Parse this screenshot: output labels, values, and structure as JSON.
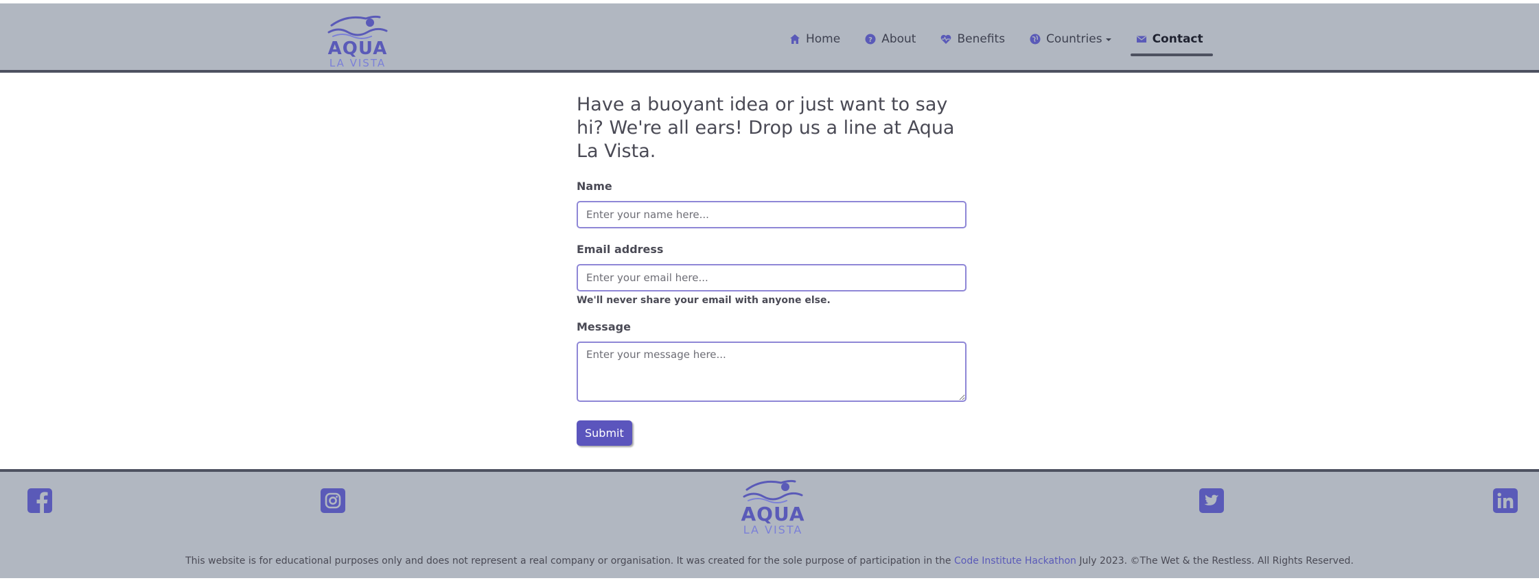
{
  "brand": {
    "name_top": "AQUA",
    "name_bottom": "LA VISTA"
  },
  "nav": {
    "items": [
      {
        "label": "Home",
        "icon": "home-icon"
      },
      {
        "label": "About",
        "icon": "question-circle-icon"
      },
      {
        "label": "Benefits",
        "icon": "heart-pulse-icon"
      },
      {
        "label": "Countries",
        "icon": "globe-icon",
        "dropdown": true
      },
      {
        "label": "Contact",
        "icon": "envelope-icon",
        "active": true
      }
    ]
  },
  "contact": {
    "heading": "Have a buoyant idea or just want to say hi? We're all ears! Drop us a line at Aqua La Vista.",
    "name_label": "Name",
    "name_placeholder": "Enter your name here...",
    "email_label": "Email address",
    "email_placeholder": "Enter your email here...",
    "email_help": "We'll never share your email with anyone else.",
    "message_label": "Message",
    "message_placeholder": "Enter your message here...",
    "submit_label": "Submit"
  },
  "footer": {
    "social": [
      "facebook-icon",
      "instagram-icon",
      "twitter-icon",
      "linkedin-icon"
    ],
    "disclaimer_before": "This website is for educational purposes only and does not represent a real company or organisation. It was created for the sole purpose of participation in the ",
    "disclaimer_link": "Code Institute Hackathon",
    "disclaimer_after": " July 2023. ©The Wet & the Restless. All Rights Reserved."
  },
  "colors": {
    "nav_bg": "#b1b7c1",
    "accent": "#5a5ab8",
    "button": "#5b55bd",
    "border_dark": "#4d5160"
  }
}
